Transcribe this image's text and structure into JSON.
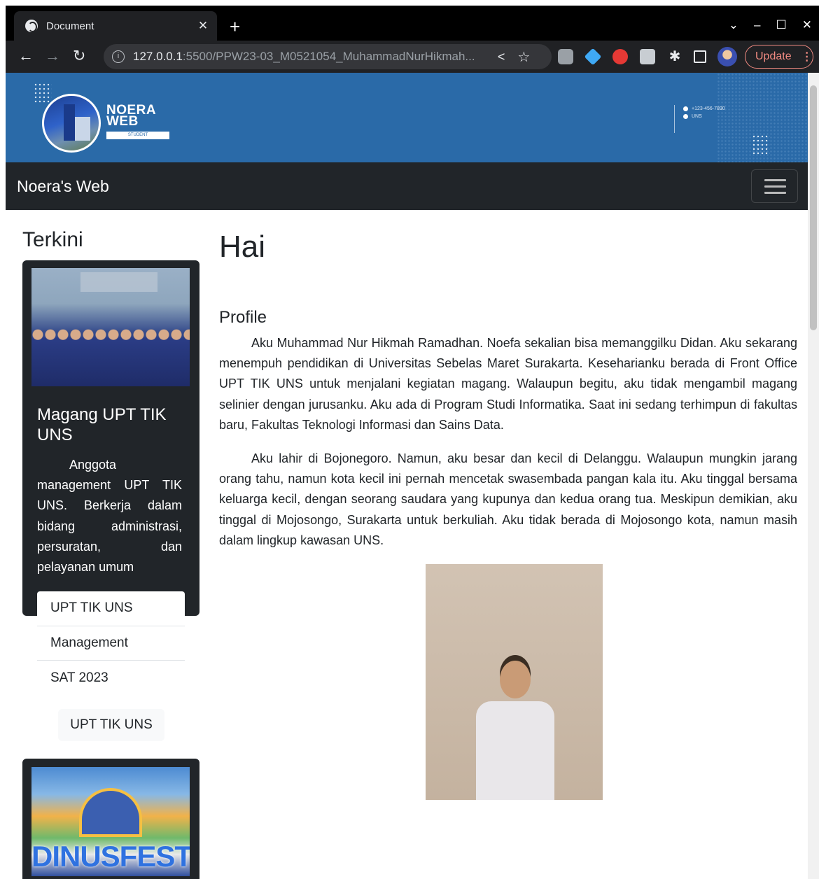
{
  "browser": {
    "tab_title": "Document",
    "tab_close": "✕",
    "new_tab": "+",
    "url_host": "127.0.0.1",
    "url_path": ":5500/PPW23-03_M0521054_MuhammadNurHikmah...",
    "update_label": "Update",
    "window_controls": [
      "⌄",
      "–",
      "☐",
      "✕"
    ]
  },
  "banner": {
    "logo_name_line1": "NOERA",
    "logo_name_line2": "WEB",
    "logo_sub": "STUDENT",
    "contact_phone": "+123-456-7890",
    "contact_place": "UNS"
  },
  "navbar": {
    "brand": "Noera's Web"
  },
  "sidebar": {
    "title": "Terkini",
    "card1": {
      "title": "Magang UPT TIK UNS",
      "text": "Anggota management UPT TIK UNS. Berkerja dalam bidang administrasi, persuratan, dan pelayanan umum",
      "list": [
        "UPT TIK UNS",
        "Management",
        "SAT 2023"
      ],
      "button": "UPT TIK UNS"
    },
    "card2": {
      "image_text": "DINUSFEST"
    }
  },
  "main": {
    "heading": "Hai",
    "profile_title": "Profile",
    "paragraph1": "Aku Muhammad Nur Hikmah Ramadhan. Noefa sekalian bisa memanggilku Didan. Aku sekarang menempuh pendidikan di Universitas Sebelas Maret Surakarta. Keseharianku berada di Front Office UPT TIK UNS untuk menjalani kegiatan magang. Walaupun begitu, aku tidak mengambil magang selinier dengan jurusanku. Aku ada di Program Studi Informatika. Saat ini sedang terhimpun di fakultas baru, Fakultas Teknologi Informasi dan Sains Data.",
    "paragraph2": "Aku lahir di Bojonegoro. Namun, aku besar dan kecil di Delanggu. Walaupun mungkin jarang orang tahu, namun kota kecil ini pernah mencetak swasembada pangan kala itu. Aku tinggal bersama keluarga kecil, dengan seorang saudara yang kupunya dan kedua orang tua. Meskipun demikian, aku tinggal di Mojosongo, Surakarta untuk berkuliah. Aku tidak berada di Mojosongo kota, namun masih dalam lingkup kawasan UNS."
  }
}
